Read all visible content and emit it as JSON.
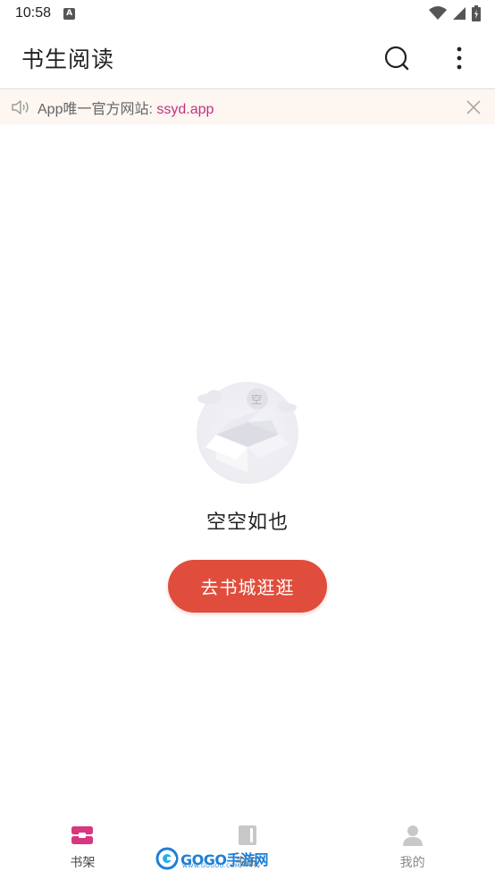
{
  "status_bar": {
    "time": "10:58",
    "notification_icon_letter": "A"
  },
  "app_bar": {
    "title": "书生阅读"
  },
  "notice": {
    "text": "App唯一官方网站: ",
    "link_text": "ssyd.app"
  },
  "empty_state": {
    "illustration_label": "空",
    "message": "空空如也",
    "cta_label": "去书城逛逛"
  },
  "bottom_nav": {
    "items": [
      {
        "label": "书架",
        "icon": "bookshelf-icon",
        "active": true
      },
      {
        "label": "书城",
        "icon": "book-icon",
        "active": false
      },
      {
        "label": "我的",
        "icon": "profile-icon",
        "active": false
      }
    ]
  },
  "watermark": {
    "text": "GOGO手游网",
    "subtext": "WWW.GOGOO.COM"
  },
  "colors": {
    "accent": "#c0337f",
    "cta": "#e04d3c",
    "notice_bg": "#fdf6f1",
    "nav_active_icon": "#d8377f",
    "nav_inactive_icon": "#c8c8c8"
  }
}
